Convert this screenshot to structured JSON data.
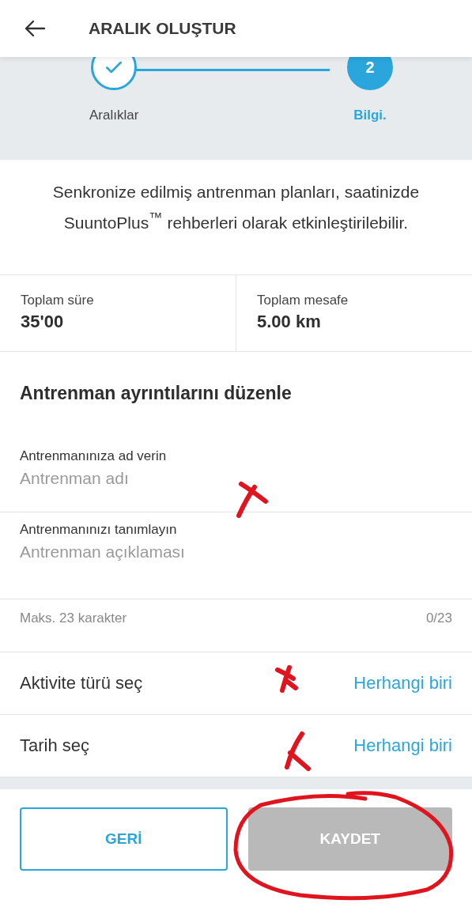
{
  "header": {
    "title": "ARALIK OLUŞTUR"
  },
  "steps": [
    {
      "label": "Aralıklar",
      "completed": true,
      "selected": false
    },
    {
      "label": "Bilgi.",
      "number": "2",
      "completed": false,
      "selected": true
    }
  ],
  "intro": "Senkronize edilmiş antrenman planları, saatinizde SuuntoPlus$^{™}$ rehberleri olarak etkinleştirilebilir.",
  "stats": [
    {
      "label": "Toplam süre",
      "value": "35'00"
    },
    {
      "label": "Toplam mesafe",
      "value": "5.00 km"
    }
  ],
  "section_title": "Antrenman ayrıntılarını düzenle",
  "fields": [
    {
      "label": "Antrenmanınıza ad verin",
      "placeholder": "Antrenman adı"
    },
    {
      "label": "Antrenmanınızı tanımlayın",
      "placeholder": "Antrenman açıklaması"
    }
  ],
  "hint": {
    "text": "Maks. 23 karakter",
    "count": "0/23"
  },
  "options": [
    {
      "label": "Aktivite türü seç",
      "value": "Herhangi biri"
    },
    {
      "label": "Tarih seç",
      "value": "Herhangi biri"
    }
  ],
  "buttons": [
    {
      "label": "GERİ",
      "disabled": false
    },
    {
      "label": "KAYDET",
      "disabled": true
    }
  ]
}
